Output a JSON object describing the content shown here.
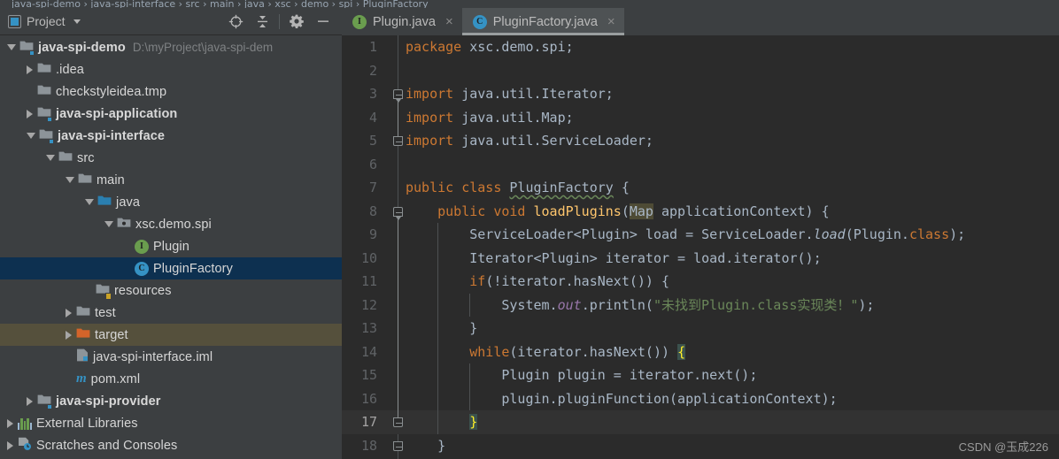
{
  "window": {
    "theme": "darcula",
    "accent_blue": "#3592c4",
    "selection_blue": "#0d3050",
    "hover_olive": "#55503c",
    "editor_bg": "#2b2b2b",
    "panel_bg": "#3c3f41"
  },
  "sidebar": {
    "title": "Project",
    "title_icon": "project-panel-icon",
    "dropdown_icon": "chevron-down-icon",
    "tools": [
      {
        "name": "locate-in-tree-icon",
        "tooltip": "Select Opened File"
      },
      {
        "name": "collapse-all-icon",
        "tooltip": "Collapse All"
      },
      {
        "name": "gear-icon",
        "tooltip": "Settings"
      },
      {
        "name": "minimize-icon",
        "tooltip": "Hide"
      }
    ],
    "tree": [
      {
        "label": "java-spi-demo",
        "path": "D:\\myProject\\java-spi-dem",
        "indent": 0,
        "arrow": "open",
        "icon": "module-folder-icon",
        "bold": true,
        "state": "normal"
      },
      {
        "label": ".idea",
        "path": "",
        "indent": 1,
        "arrow": "closed",
        "icon": "folder-icon",
        "bold": false,
        "state": "normal"
      },
      {
        "label": "checkstyleidea.tmp",
        "path": "",
        "indent": 1,
        "arrow": "none",
        "icon": "folder-icon",
        "bold": false,
        "state": "normal"
      },
      {
        "label": "java-spi-application",
        "path": "",
        "indent": 1,
        "arrow": "closed",
        "icon": "module-folder-icon",
        "bold": true,
        "state": "normal"
      },
      {
        "label": "java-spi-interface",
        "path": "",
        "indent": 1,
        "arrow": "open",
        "icon": "module-folder-icon",
        "bold": true,
        "state": "normal"
      },
      {
        "label": "src",
        "path": "",
        "indent": 2,
        "arrow": "open",
        "icon": "folder-icon",
        "bold": false,
        "state": "normal"
      },
      {
        "label": "main",
        "path": "",
        "indent": 3,
        "arrow": "open",
        "icon": "folder-icon",
        "bold": false,
        "state": "normal"
      },
      {
        "label": "java",
        "path": "",
        "indent": 4,
        "arrow": "open",
        "icon": "source-root-folder-icon",
        "bold": false,
        "state": "normal"
      },
      {
        "label": "xsc.demo.spi",
        "path": "",
        "indent": 5,
        "arrow": "open",
        "icon": "package-icon",
        "bold": false,
        "state": "normal"
      },
      {
        "label": "Plugin",
        "path": "",
        "indent": 6,
        "arrow": "none",
        "icon": "interface-icon",
        "bold": false,
        "state": "normal"
      },
      {
        "label": "PluginFactory",
        "path": "",
        "indent": 6,
        "arrow": "none",
        "icon": "class-icon",
        "bold": false,
        "state": "selected"
      },
      {
        "label": "resources",
        "path": "",
        "indent": 4,
        "arrow": "none",
        "icon": "resources-folder-icon",
        "bold": false,
        "state": "normal"
      },
      {
        "label": "test",
        "path": "",
        "indent": 3,
        "arrow": "closed",
        "icon": "folder-icon",
        "bold": false,
        "state": "normal"
      },
      {
        "label": "target",
        "path": "",
        "indent": 3,
        "arrow": "closed",
        "icon": "excluded-folder-icon",
        "bold": false,
        "state": "hovered"
      },
      {
        "label": "java-spi-interface.iml",
        "path": "",
        "indent": 3,
        "arrow": "none",
        "icon": "iml-file-icon",
        "bold": false,
        "state": "normal"
      },
      {
        "label": "pom.xml",
        "path": "",
        "indent": 3,
        "arrow": "none",
        "icon": "maven-icon",
        "bold": false,
        "state": "normal"
      },
      {
        "label": "java-spi-provider",
        "path": "",
        "indent": 1,
        "arrow": "closed",
        "icon": "module-folder-icon",
        "bold": true,
        "state": "normal"
      },
      {
        "label": "External Libraries",
        "path": "",
        "indent": 0,
        "arrow": "closed",
        "icon": "libraries-icon",
        "bold": false,
        "state": "normal"
      },
      {
        "label": "Scratches and Consoles",
        "path": "",
        "indent": 0,
        "arrow": "closed",
        "icon": "scratches-icon",
        "bold": false,
        "state": "normal"
      }
    ]
  },
  "editor": {
    "tabs": [
      {
        "label": "Plugin.java",
        "icon": "interface-icon",
        "active": false,
        "close_glyph": "×"
      },
      {
        "label": "PluginFactory.java",
        "icon": "class-icon",
        "active": true,
        "close_glyph": "×"
      }
    ],
    "caret_line": 17,
    "lines": [
      {
        "n": "1",
        "text": "package xsc.demo.spi;"
      },
      {
        "n": "2",
        "text": ""
      },
      {
        "n": "3",
        "text": "import java.util.Iterator;"
      },
      {
        "n": "4",
        "text": "import java.util.Map;"
      },
      {
        "n": "5",
        "text": "import java.util.ServiceLoader;"
      },
      {
        "n": "6",
        "text": ""
      },
      {
        "n": "7",
        "text": "public class PluginFactory {"
      },
      {
        "n": "8",
        "text": "    public void loadPlugins(Map applicationContext) {"
      },
      {
        "n": "9",
        "text": "        ServiceLoader<Plugin> load = ServiceLoader.load(Plugin.class);"
      },
      {
        "n": "10",
        "text": "        Iterator<Plugin> iterator = load.iterator();"
      },
      {
        "n": "11",
        "text": "        if(!iterator.hasNext()) {"
      },
      {
        "n": "12",
        "text": "            System.out.println(\"未找到Plugin.class实现类！\");"
      },
      {
        "n": "13",
        "text": "        }"
      },
      {
        "n": "14",
        "text": "        while(iterator.hasNext()) {"
      },
      {
        "n": "15",
        "text": "            Plugin plugin = iterator.next();"
      },
      {
        "n": "16",
        "text": "            plugin.pluginFunction(applicationContext);"
      },
      {
        "n": "17",
        "text": "        }"
      },
      {
        "n": "18",
        "text": "    }"
      }
    ],
    "highlighted_identifier": "Map",
    "string_literal_line12": "\"未找到Plugin.class实现类！\""
  },
  "watermark": "CSDN @玉成226"
}
